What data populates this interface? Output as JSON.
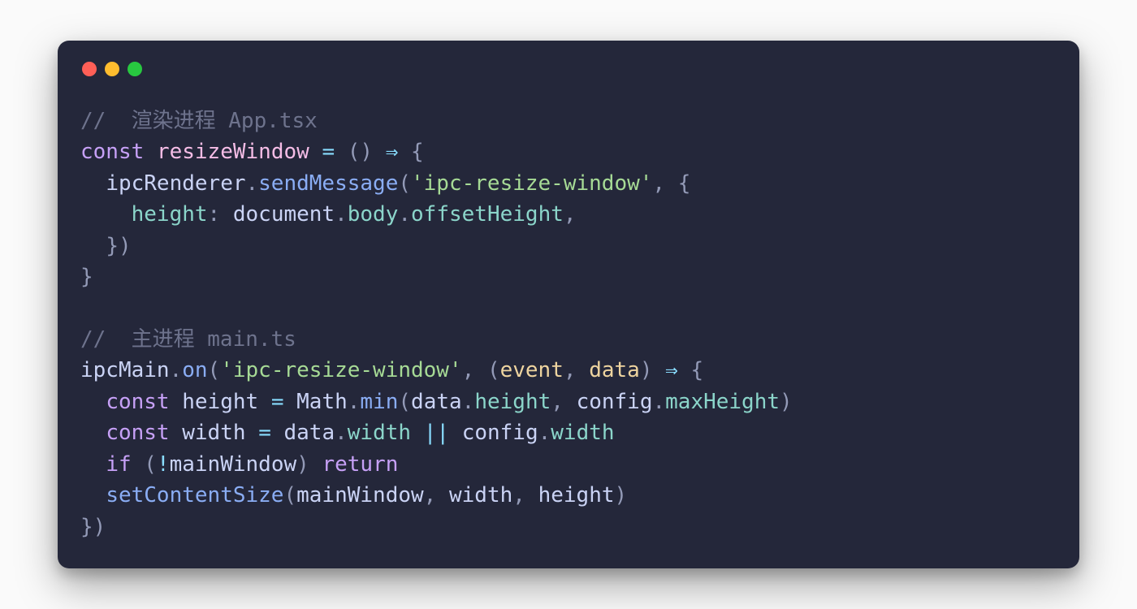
{
  "colors": {
    "bg": "#24273a",
    "red": "#ff5f57",
    "yellow": "#febc2e",
    "green": "#28c840"
  },
  "code": {
    "tokens": [
      [
        [
          "c-comment",
          "//  渲染进程 App.tsx"
        ]
      ],
      [
        [
          "c-keyword",
          "const"
        ],
        [
          "c-default",
          " "
        ],
        [
          "c-pink",
          "resizeWindow"
        ],
        [
          "c-default",
          " "
        ],
        [
          "c-op",
          "="
        ],
        [
          "c-default",
          " "
        ],
        [
          "c-punct",
          "()"
        ],
        [
          "c-default",
          " "
        ],
        [
          "c-op",
          "⇒"
        ],
        [
          "c-default",
          " "
        ],
        [
          "c-punct",
          "{"
        ]
      ],
      [
        [
          "c-default",
          "  "
        ],
        [
          "c-default",
          "ipcRenderer"
        ],
        [
          "c-punct",
          "."
        ],
        [
          "c-func",
          "sendMessage"
        ],
        [
          "c-punct",
          "("
        ],
        [
          "c-string",
          "'ipc-resize-window'"
        ],
        [
          "c-punct",
          ","
        ],
        [
          "c-default",
          " "
        ],
        [
          "c-punct",
          "{"
        ]
      ],
      [
        [
          "c-default",
          "    "
        ],
        [
          "c-prop",
          "height"
        ],
        [
          "c-punct",
          ":"
        ],
        [
          "c-default",
          " "
        ],
        [
          "c-default",
          "document"
        ],
        [
          "c-punct",
          "."
        ],
        [
          "c-prop",
          "body"
        ],
        [
          "c-punct",
          "."
        ],
        [
          "c-prop",
          "offsetHeight"
        ],
        [
          "c-punct",
          ","
        ]
      ],
      [
        [
          "c-default",
          "  "
        ],
        [
          "c-punct",
          "})"
        ]
      ],
      [
        [
          "c-punct",
          "}"
        ]
      ],
      [],
      [
        [
          "c-comment",
          "//  主进程 main.ts"
        ]
      ],
      [
        [
          "c-default",
          "ipcMain"
        ],
        [
          "c-punct",
          "."
        ],
        [
          "c-func",
          "on"
        ],
        [
          "c-punct",
          "("
        ],
        [
          "c-string",
          "'ipc-resize-window'"
        ],
        [
          "c-punct",
          ","
        ],
        [
          "c-default",
          " "
        ],
        [
          "c-punct",
          "("
        ],
        [
          "c-param",
          "event"
        ],
        [
          "c-punct",
          ","
        ],
        [
          "c-default",
          " "
        ],
        [
          "c-param",
          "data"
        ],
        [
          "c-punct",
          ")"
        ],
        [
          "c-default",
          " "
        ],
        [
          "c-op",
          "⇒"
        ],
        [
          "c-default",
          " "
        ],
        [
          "c-punct",
          "{"
        ]
      ],
      [
        [
          "c-default",
          "  "
        ],
        [
          "c-keyword",
          "const"
        ],
        [
          "c-default",
          " "
        ],
        [
          "c-default",
          "height"
        ],
        [
          "c-default",
          " "
        ],
        [
          "c-op",
          "="
        ],
        [
          "c-default",
          " "
        ],
        [
          "c-default",
          "Math"
        ],
        [
          "c-punct",
          "."
        ],
        [
          "c-func",
          "min"
        ],
        [
          "c-punct",
          "("
        ],
        [
          "c-default",
          "data"
        ],
        [
          "c-punct",
          "."
        ],
        [
          "c-prop",
          "height"
        ],
        [
          "c-punct",
          ","
        ],
        [
          "c-default",
          " "
        ],
        [
          "c-default",
          "config"
        ],
        [
          "c-punct",
          "."
        ],
        [
          "c-prop",
          "maxHeight"
        ],
        [
          "c-punct",
          ")"
        ]
      ],
      [
        [
          "c-default",
          "  "
        ],
        [
          "c-keyword",
          "const"
        ],
        [
          "c-default",
          " "
        ],
        [
          "c-default",
          "width"
        ],
        [
          "c-default",
          " "
        ],
        [
          "c-op",
          "="
        ],
        [
          "c-default",
          " "
        ],
        [
          "c-default",
          "data"
        ],
        [
          "c-punct",
          "."
        ],
        [
          "c-prop",
          "width"
        ],
        [
          "c-default",
          " "
        ],
        [
          "c-op",
          "||"
        ],
        [
          "c-default",
          " "
        ],
        [
          "c-default",
          "config"
        ],
        [
          "c-punct",
          "."
        ],
        [
          "c-prop",
          "width"
        ]
      ],
      [
        [
          "c-default",
          "  "
        ],
        [
          "c-keyword",
          "if"
        ],
        [
          "c-default",
          " "
        ],
        [
          "c-punct",
          "("
        ],
        [
          "c-op",
          "!"
        ],
        [
          "c-default",
          "mainWindow"
        ],
        [
          "c-punct",
          ")"
        ],
        [
          "c-default",
          " "
        ],
        [
          "c-keyword",
          "return"
        ]
      ],
      [
        [
          "c-default",
          "  "
        ],
        [
          "c-func",
          "setContentSize"
        ],
        [
          "c-punct",
          "("
        ],
        [
          "c-default",
          "mainWindow"
        ],
        [
          "c-punct",
          ","
        ],
        [
          "c-default",
          " "
        ],
        [
          "c-default",
          "width"
        ],
        [
          "c-punct",
          ","
        ],
        [
          "c-default",
          " "
        ],
        [
          "c-default",
          "height"
        ],
        [
          "c-punct",
          ")"
        ]
      ],
      [
        [
          "c-punct",
          "})"
        ]
      ]
    ]
  }
}
